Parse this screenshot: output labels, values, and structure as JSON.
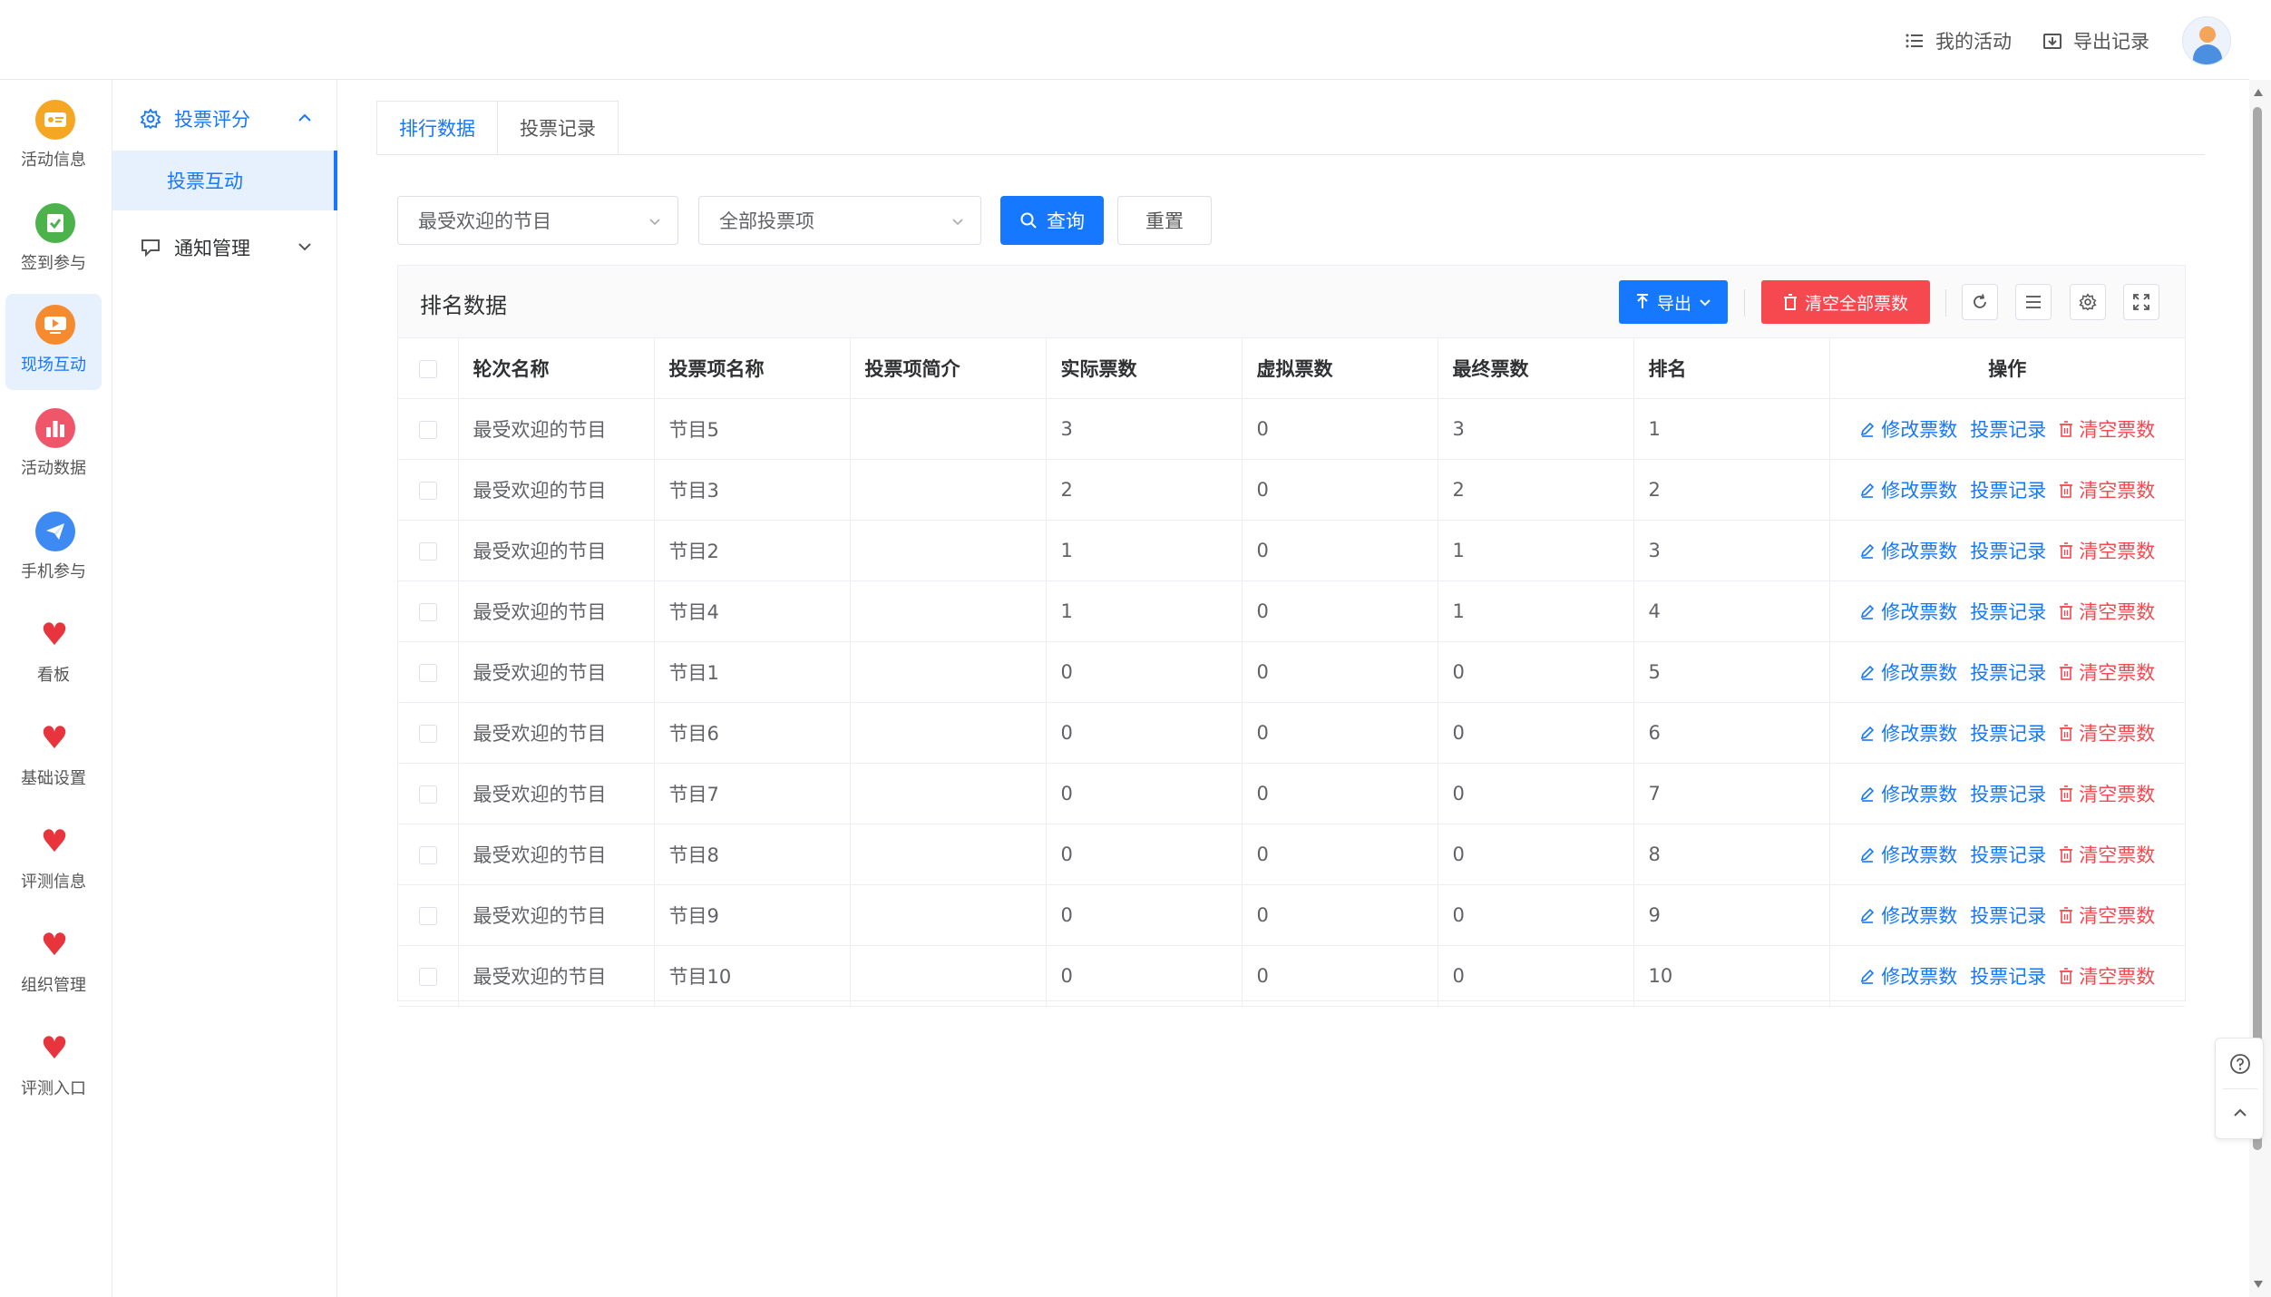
{
  "header": {
    "my_activity": "我的活动",
    "export_records": "导出记录"
  },
  "rail": {
    "items": [
      {
        "label": "活动信息",
        "icon": "ticket-icon",
        "color": "#f5a623"
      },
      {
        "label": "签到参与",
        "icon": "checkin-icon",
        "color": "#4cb34c"
      },
      {
        "label": "现场互动",
        "icon": "live-icon",
        "color": "#f58a2e"
      },
      {
        "label": "活动数据",
        "icon": "chart-icon",
        "color": "#f0566a"
      },
      {
        "label": "手机参与",
        "icon": "paper-plane-icon",
        "color": "#3d8bf2"
      },
      {
        "label": "看板",
        "icon": "heart-icon",
        "color": "#e8343d"
      },
      {
        "label": "基础设置",
        "icon": "heart-icon",
        "color": "#e8343d"
      },
      {
        "label": "评测信息",
        "icon": "heart-icon",
        "color": "#e8343d"
      },
      {
        "label": "组织管理",
        "icon": "heart-icon",
        "color": "#e8343d"
      },
      {
        "label": "评测入口",
        "icon": "heart-icon",
        "color": "#e8343d"
      }
    ]
  },
  "submenu": {
    "group1": "投票评分",
    "group1_child": "投票互动",
    "group2": "通知管理"
  },
  "tabs": [
    "排行数据",
    "投票记录"
  ],
  "filters": {
    "round_select": "最受欢迎的节目",
    "item_select": "全部投票项",
    "query": "查询",
    "reset": "重置"
  },
  "panel": {
    "title": "排名数据",
    "export": "导出",
    "clear_all": "清空全部票数"
  },
  "table": {
    "headers": [
      "轮次名称",
      "投票项名称",
      "投票项简介",
      "实际票数",
      "虚拟票数",
      "最终票数",
      "排名",
      "操作"
    ],
    "actions": {
      "edit": "修改票数",
      "records": "投票记录",
      "clear": "清空票数"
    },
    "rows": [
      {
        "round": "最受欢迎的节目",
        "item": "节目5",
        "intro": "",
        "actual": "3",
        "virtual": "0",
        "final": "3",
        "rank": "1"
      },
      {
        "round": "最受欢迎的节目",
        "item": "节目3",
        "intro": "",
        "actual": "2",
        "virtual": "0",
        "final": "2",
        "rank": "2"
      },
      {
        "round": "最受欢迎的节目",
        "item": "节目2",
        "intro": "",
        "actual": "1",
        "virtual": "0",
        "final": "1",
        "rank": "3"
      },
      {
        "round": "最受欢迎的节目",
        "item": "节目4",
        "intro": "",
        "actual": "1",
        "virtual": "0",
        "final": "1",
        "rank": "4"
      },
      {
        "round": "最受欢迎的节目",
        "item": "节目1",
        "intro": "",
        "actual": "0",
        "virtual": "0",
        "final": "0",
        "rank": "5"
      },
      {
        "round": "最受欢迎的节目",
        "item": "节目6",
        "intro": "",
        "actual": "0",
        "virtual": "0",
        "final": "0",
        "rank": "6"
      },
      {
        "round": "最受欢迎的节目",
        "item": "节目7",
        "intro": "",
        "actual": "0",
        "virtual": "0",
        "final": "0",
        "rank": "7"
      },
      {
        "round": "最受欢迎的节目",
        "item": "节目8",
        "intro": "",
        "actual": "0",
        "virtual": "0",
        "final": "0",
        "rank": "8"
      },
      {
        "round": "最受欢迎的节目",
        "item": "节目9",
        "intro": "",
        "actual": "0",
        "virtual": "0",
        "final": "0",
        "rank": "9"
      },
      {
        "round": "最受欢迎的节目",
        "item": "节目10",
        "intro": "",
        "actual": "0",
        "virtual": "0",
        "final": "0",
        "rank": "10"
      }
    ]
  }
}
